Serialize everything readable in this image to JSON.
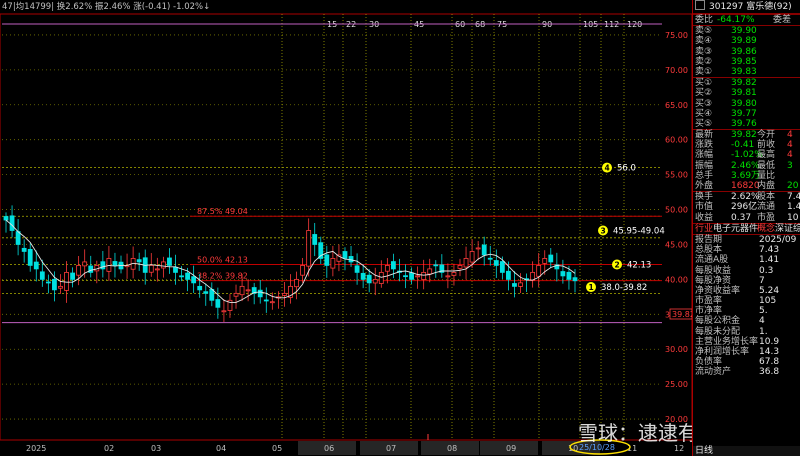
{
  "chart_data": {
    "type": "candlestick",
    "top_bar": "47|均14799| 换2.62% 振2.46% 涨(-0.41) -1.02%↓",
    "y_axis": {
      "ticks": [
        75.0,
        70.0,
        65.0,
        60.0,
        55.0,
        50.0,
        45.0,
        40.0,
        35.0,
        30.0,
        25.0,
        20.0
      ],
      "range": [
        17.0,
        78.0
      ]
    },
    "x_months": [
      "2025",
      "02",
      "03",
      "04",
      "05",
      "06",
      "07",
      "08",
      "09",
      "10",
      "11",
      "12"
    ],
    "fib_day_labels": [
      "15",
      "22",
      "30",
      "45",
      "60",
      "68",
      "75",
      "90",
      "105",
      "112",
      "120"
    ],
    "price_tag": "39.82",
    "annotations": [
      {
        "id": "4",
        "text": "56.0",
        "price": 56.0
      },
      {
        "id": "3",
        "text": "45.95-49.04",
        "price": 47.0
      },
      {
        "id": "2",
        "text": "42.13",
        "price": 42.13
      },
      {
        "id": "1",
        "text": "38.0-39.82",
        "price": 38.9
      }
    ],
    "fib_levels": [
      {
        "text": "87.5% 49.04",
        "price": 49.04
      },
      {
        "text": "50.0% 42.13",
        "price": 42.13
      },
      {
        "text": "38.2% 39.82",
        "price": 39.82
      }
    ],
    "bottom_note": "25/10/28",
    "close_series": [
      48.5,
      47,
      45,
      44,
      42,
      41.5,
      40,
      39.5,
      38.5,
      39,
      41,
      40,
      42,
      42.5,
      41,
      42,
      41.5,
      43,
      42,
      41.5,
      42,
      43,
      42.5,
      41,
      42,
      41.5,
      42.5,
      42,
      41,
      40.5,
      40,
      39.5,
      38.5,
      38,
      37,
      36,
      35.5,
      37,
      38,
      39,
      38.5,
      38,
      37.5,
      37,
      36.8,
      37.5,
      38,
      39,
      40,
      42,
      47,
      45,
      43,
      42,
      43,
      43.5,
      43,
      42.5,
      41,
      40,
      39.5,
      40,
      41,
      42,
      41.5,
      41,
      40.5,
      40,
      40.5,
      41,
      41.5,
      42,
      41,
      40.5,
      41,
      42,
      43,
      44,
      44.5,
      43.5,
      43,
      42,
      41,
      40,
      39,
      39.5,
      40,
      41,
      42,
      43,
      42.5,
      41.5,
      40.5,
      40,
      39.8
    ]
  },
  "quote": {
    "header": "301297 富乐德(92)",
    "weibi": {
      "label": "委比",
      "value": "-64.17%",
      "label2": "委差"
    },
    "asks": [
      {
        "label": "卖⑤",
        "price": "39.90"
      },
      {
        "label": "卖④",
        "price": "39.89"
      },
      {
        "label": "卖③",
        "price": "39.86"
      },
      {
        "label": "卖②",
        "price": "39.85"
      },
      {
        "label": "卖①",
        "price": "39.83"
      }
    ],
    "bids": [
      {
        "label": "买①",
        "price": "39.82"
      },
      {
        "label": "买②",
        "price": "39.81"
      },
      {
        "label": "买③",
        "price": "39.80"
      },
      {
        "label": "买④",
        "price": "39.77"
      },
      {
        "label": "买⑤",
        "price": "39.76"
      }
    ],
    "stats": [
      {
        "l1": "最新",
        "v1": "39.82",
        "l2": "今开",
        "v2": "4"
      },
      {
        "l1": "涨跌",
        "v1": "-0.41",
        "l2": "前收",
        "v2": "4"
      },
      {
        "l1": "涨幅",
        "v1": "-1.02%",
        "l2": "最高",
        "v2": "4"
      },
      {
        "l1": "振幅",
        "v1": "2.46%",
        "l2": "最低",
        "v2": "3"
      },
      {
        "l1": "总手",
        "v1": "3.69万",
        "l2": "量比",
        "v2": ""
      },
      {
        "l1": "外盘",
        "v1": "16820",
        "l2": "内盘",
        "v2": "20"
      }
    ],
    "stats2": [
      {
        "l1": "换手",
        "v1": "2.62%",
        "l2": "股本",
        "v2": "7.4"
      },
      {
        "l1": "市值",
        "v1": "296亿",
        "l2": "流通",
        "v2": "1.4"
      },
      {
        "l1": "收益",
        "v1": "0.37",
        "l2": "市盈",
        "v2": "10"
      }
    ],
    "tabs": {
      "a": "行业",
      "b": "电子元器件",
      "c": "概念",
      "d": "深证综"
    },
    "fundamentals": [
      {
        "label": "报告期",
        "value": "2025/09"
      },
      {
        "label": "总股本",
        "value": "7.43"
      },
      {
        "label": "流通A股",
        "value": "1.41"
      },
      {
        "label": "每股收益",
        "value": "0.3"
      },
      {
        "label": "每股净资",
        "value": "7"
      },
      {
        "label": "净资收益率",
        "value": "5.24"
      },
      {
        "label": "市盈率",
        "value": "105"
      },
      {
        "label": "市净率",
        "value": "5."
      },
      {
        "label": "每股公积金",
        "value": "4"
      },
      {
        "label": "每股未分配",
        "value": "1."
      },
      {
        "label": "主营业务增长率",
        "value": "10.9"
      },
      {
        "label": "净利润增长率",
        "value": "14.3"
      },
      {
        "label": "负债率",
        "value": "67.8"
      },
      {
        "label": "流动资产",
        "value": "36.8"
      }
    ],
    "bottom_tab": "日线"
  },
  "watermark": {
    "text": "雪球：逮逮有为"
  }
}
